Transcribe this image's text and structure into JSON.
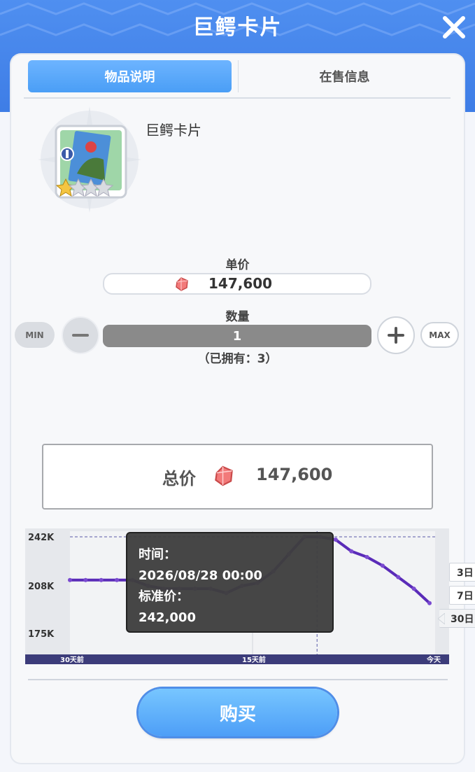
{
  "window": {
    "title": "巨鳄卡片"
  },
  "tabs": [
    {
      "label": "物品说明",
      "active": true
    },
    {
      "label": "在售信息",
      "active": false
    }
  ],
  "item": {
    "name": "巨鳄卡片",
    "icon": "card-icon",
    "stars_filled": 1,
    "stars_total": 4
  },
  "purchase": {
    "unit_price_label": "单价",
    "unit_price": "147,600",
    "quantity_label": "数量",
    "quantity": "1",
    "min_label": "MIN",
    "max_label": "MAX",
    "owned_text": "（已拥有：3）",
    "total_label": "总价",
    "total_price": "147,600",
    "buy_label": "购买"
  },
  "range_tabs": [
    {
      "label": "3日",
      "selected": false
    },
    {
      "label": "7日",
      "selected": false
    },
    {
      "label": "30日",
      "selected": true
    }
  ],
  "tooltip": {
    "time_label": "时间：",
    "time_value": "2026/08/28 00:00",
    "price_label": "标准价：",
    "price_value": "242,000"
  },
  "chart_data": {
    "type": "line",
    "y_tick_labels": [
      "242K",
      "208K",
      "175K"
    ],
    "x_tick_labels": [
      "30天前",
      "15天前",
      "今天"
    ],
    "ylim": [
      175000,
      242000
    ],
    "series": [
      {
        "values": [
          212000,
          212000,
          212000,
          212000,
          212000,
          208000,
          206000,
          206000,
          206000,
          206000,
          203000,
          208000,
          210000,
          218000,
          230000,
          242000,
          242000,
          240000,
          232000,
          228000,
          222000,
          214000,
          206000,
          196000
        ]
      }
    ],
    "highlight_index": 15,
    "line_color": "#5a2bb8",
    "grid": true
  },
  "colors": {
    "header": "#3e7de6",
    "tab_active": "#4a9ef6",
    "chart_line": "#5a2bb8",
    "axis_bar": "#3c3c7a"
  }
}
